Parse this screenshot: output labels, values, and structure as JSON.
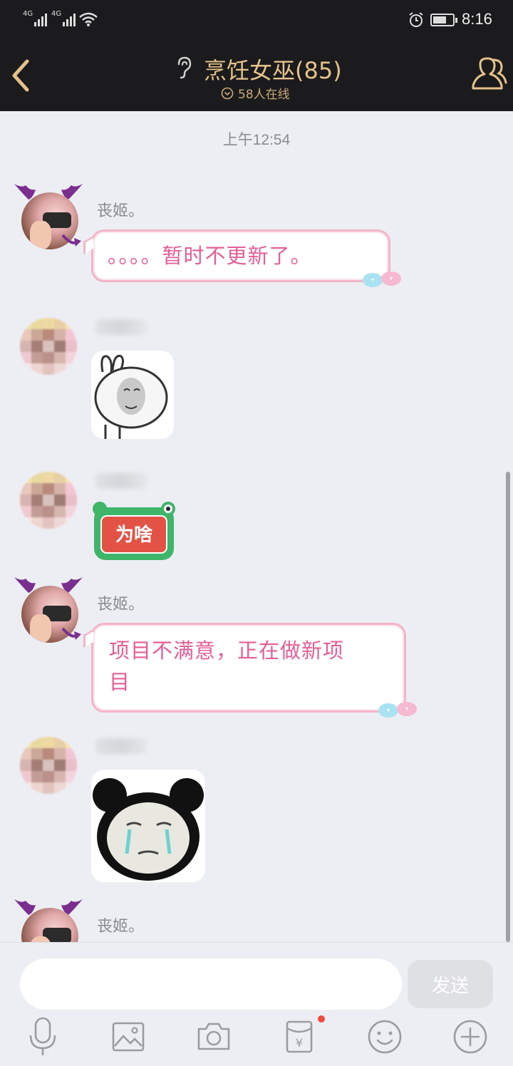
{
  "status": {
    "time": "8:16",
    "sim1": "4G",
    "sim2": "4G"
  },
  "header": {
    "title": "烹饪女巫(85)",
    "online": "58人在线"
  },
  "chat": {
    "timestamp": "上午12:54",
    "messages": [
      {
        "sender": "丧姬。",
        "type": "text",
        "text": "。。。。暂时不更新了。"
      },
      {
        "sender": "",
        "type": "sticker",
        "sticker": "rabbit-face-sticker"
      },
      {
        "sender": "",
        "type": "sticker",
        "sticker": "frog-weisha-sticker",
        "sticker_text": "为啥"
      },
      {
        "sender": "丧姬。",
        "type": "text",
        "text": "项目不满意，正在做新项\n目"
      },
      {
        "sender": "",
        "type": "sticker",
        "sticker": "crying-panda-sticker"
      },
      {
        "sender": "丧姬。",
        "type": "text",
        "text": ""
      }
    ]
  },
  "input": {
    "placeholder": "",
    "send_label": "发送"
  },
  "toolbar": [
    "mic-icon",
    "image-icon",
    "camera-icon",
    "red-packet-icon",
    "emoji-icon",
    "plus-icon"
  ],
  "colors": {
    "header_bg": "#1b1b1d",
    "header_gold": "#e5c28a",
    "bubble_text": "#e45e96",
    "bubble_border": "#f3b4c8",
    "badge": "#f04a3e"
  }
}
